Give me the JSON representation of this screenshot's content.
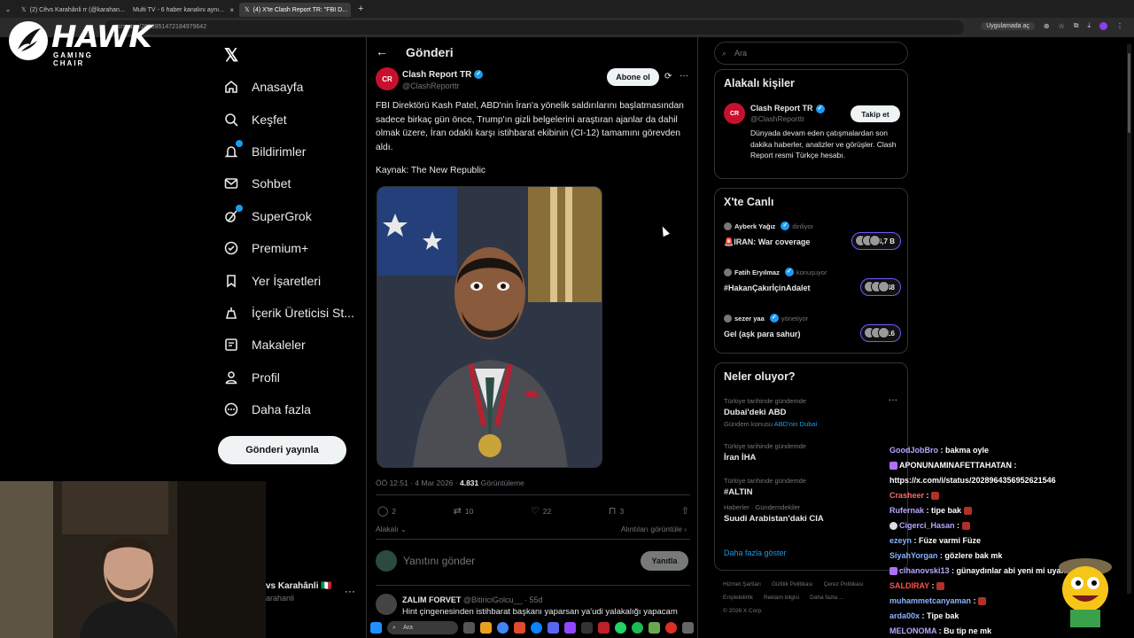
{
  "browser": {
    "tabs": [
      {
        "label": "(2) Cêvs Karahânli rr (@karahan..."
      },
      {
        "label": "Multi TV - 6 haber kanalını aynı..."
      },
      {
        "label": "(4) X'te Clash Report TR: \"FBI D..."
      }
    ],
    "url": "rttr/status/2028951472184979642",
    "app_pill": "Uygulamada aç"
  },
  "overlay_logo": {
    "word": "HAWK",
    "sub": "GAMING CHAIR"
  },
  "nav": {
    "items": [
      {
        "label": "Anasayfa",
        "icon": "home-icon"
      },
      {
        "label": "Keşfet",
        "icon": "search-icon"
      },
      {
        "label": "Bildirimler",
        "icon": "bell-icon"
      },
      {
        "label": "Sohbet",
        "icon": "mail-icon"
      },
      {
        "label": "SuperGrok",
        "icon": "grok-icon"
      },
      {
        "label": "Premium+",
        "icon": "premium-icon"
      },
      {
        "label": "Yer İşaretleri",
        "icon": "bookmark-icon"
      },
      {
        "label": "İçerik Üreticisi St...",
        "icon": "creator-icon"
      },
      {
        "label": "Makaleler",
        "icon": "articles-icon"
      },
      {
        "label": "Profil",
        "icon": "person-icon"
      },
      {
        "label": "Daha fazla",
        "icon": "more-circle-icon"
      }
    ],
    "post_button": "Gönderi yayınla",
    "account_name": "vs Karahânli 🇮🇹",
    "account_handle": "arahanli"
  },
  "post": {
    "header": "Gönderi",
    "author_name": "Clash Report TR",
    "author_handle": "@ClashReporttr",
    "subscribe": "Abone ol",
    "text": "FBI Direktörü Kash Patel, ABD'nin İran'a yönelik saldırılarını başlatmasından sadece birkaç gün önce, Trump'ın gizli belgelerini araştıran ajanlar da dahil olmak üzere, İran odaklı karşı istihbarat ekibinin (CI-12) tamamını görevden aldı.",
    "source": "Kaynak: The New Republic",
    "time": "ÖÖ 12:51 · 4 Mar 2026 ·",
    "views": "4.831",
    "views_label": "Görüntüleme",
    "replies": "2",
    "reposts": "10",
    "likes": "22",
    "bookmarks": "3",
    "related": "Alakalı",
    "quotes": "Alıntıları görüntüle",
    "reply_placeholder": "Yanıtını gönder",
    "reply_button": "Yanıtla",
    "reply2_name": "ZALIM FORVET",
    "reply2_handle": "@BitiriciGolcu__ · 55d",
    "reply2_text": "Hint çingenesinden istihbarat başkanı yaparsan ya'udi yalakalığı yapacam"
  },
  "right": {
    "search_placeholder": "Ara",
    "related_title": "Alakalı kişiler",
    "rp_name": "Clash Report TR",
    "rp_handle": "@ClashReporttr",
    "follow": "Takip et",
    "rp_bio": "Dünyada devam eden çatışmalardan son dakika haberler, analizler ve görüşler. Clash Report resmi Türkçe hesabı.",
    "live_title": "X'te Canlı",
    "live": [
      {
        "host": "Ayberk Yağız",
        "status": "dinliyor",
        "title": "🚨IRAN: War coverage",
        "count": "+4,7 B"
      },
      {
        "host": "Fatih Eryılmaz",
        "status": "konuşuyor",
        "title": "#HakanÇakırİçinAdalet",
        "count": "+48"
      },
      {
        "host": "sezer yaa",
        "status": "yönetiyor",
        "title": "Gel (aşk para sahur)",
        "count": "+16"
      }
    ],
    "trends_title": "Neler oluyor?",
    "trends": [
      {
        "ctx": "Türkiye tarihinde gündemde",
        "title": "Dubai'deki ABD",
        "sub": "Gündem konusu",
        "sub_link": "ABD'nin Dubai"
      },
      {
        "ctx": "Türkiye tarihinde gündemde",
        "title": "İran İHA",
        "sub": "",
        "sub_link": ""
      },
      {
        "ctx": "Türkiye tarihinde gündemde",
        "title": "#ALTIN",
        "sub": "",
        "sub_link": ""
      },
      {
        "ctx": "Haberler · Gündemdekiler",
        "title": "Suudi Arabistan'daki CIA",
        "sub": "",
        "sub_link": ""
      }
    ],
    "more_trends": "Daha fazla göster",
    "footer": [
      "Hizmet Şartları",
      "Gizlilik Politikası",
      "Çerez Politikası",
      "Erişilebilirlik",
      "Reklam bilgisi",
      "Daha fazla ...",
      "© 2026 X Corp."
    ]
  },
  "chat": [
    {
      "user": "GoodJobBro",
      "msg": "bakma oyle",
      "color": "#b7a6ff"
    },
    {
      "user": "APONUNAMINAFETTAHATAN",
      "msg": "",
      "color": "#ffffff"
    },
    {
      "user": "",
      "msg": "https://x.com/i/status/2028964356952621546",
      "color": "#ffffff"
    },
    {
      "user": "Crasheer",
      "msg": "",
      "color": "#ff6b6b"
    },
    {
      "user": "Rufernak",
      "msg": "tipe bak",
      "color": "#b7a6ff"
    },
    {
      "user": "Cigerci_Hasan",
      "msg": "",
      "color": "#b7a6ff"
    },
    {
      "user": "ezeyn",
      "msg": "Füze varmi Füze",
      "color": "#8ab4ff"
    },
    {
      "user": "SiyahYorgan",
      "msg": "gözlere bak mk",
      "color": "#8ab4ff"
    },
    {
      "user": "cihanovski13",
      "msg": "günaydınlar abi yeni mi uyandın Cêvs",
      "color": "#b7a6ff"
    },
    {
      "user": "SALDIRAY",
      "msg": "",
      "color": "#ff4f4f"
    },
    {
      "user": "muhammetcanyaman",
      "msg": "",
      "color": "#8ab4ff"
    },
    {
      "user": "arda00x",
      "msg": "Tipe bak",
      "color": "#8ab4ff"
    },
    {
      "user": "MELONOMA",
      "msg": "Bu tip ne mk",
      "color": "#b7a6ff"
    }
  ],
  "taskbar": {
    "search": "Ara"
  }
}
